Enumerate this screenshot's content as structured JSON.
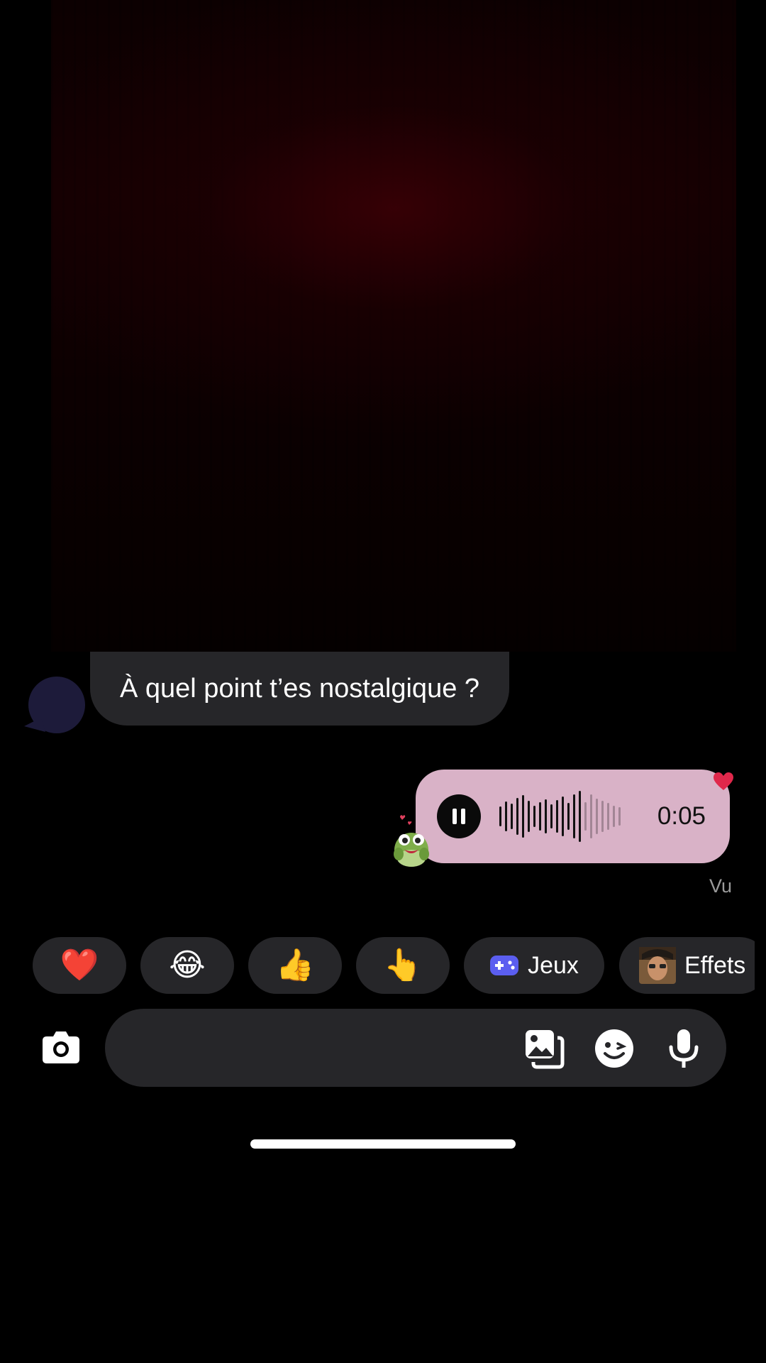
{
  "thread": {
    "received_message": "À quel point t’es nostalgique ?",
    "audio_message": {
      "duration": "0:05",
      "playback": "playing",
      "reaction": "heart"
    },
    "sticker": "frog-sticker",
    "seen_label": "Vu"
  },
  "quick_reactions": [
    {
      "emoji": "❤️",
      "label": ""
    },
    {
      "emoji": "😂",
      "label": ""
    },
    {
      "emoji": "👍",
      "label": ""
    },
    {
      "emoji": "👆",
      "label": ""
    },
    {
      "emoji": "",
      "label": "Jeux",
      "icon": "gamepad-icon"
    },
    {
      "emoji": "",
      "label": "Effets",
      "icon": "effect-thumbnail"
    }
  ],
  "composer": {
    "placeholder": "",
    "icons": [
      "camera-icon",
      "gallery-icon",
      "sticker-icon",
      "microphone-icon"
    ]
  },
  "colors": {
    "background": "#000000",
    "received_bubble": "#262629",
    "audio_bubble": "#d9b2c7",
    "gamepad": "#5b5ef0",
    "heart": "#e0284b"
  }
}
